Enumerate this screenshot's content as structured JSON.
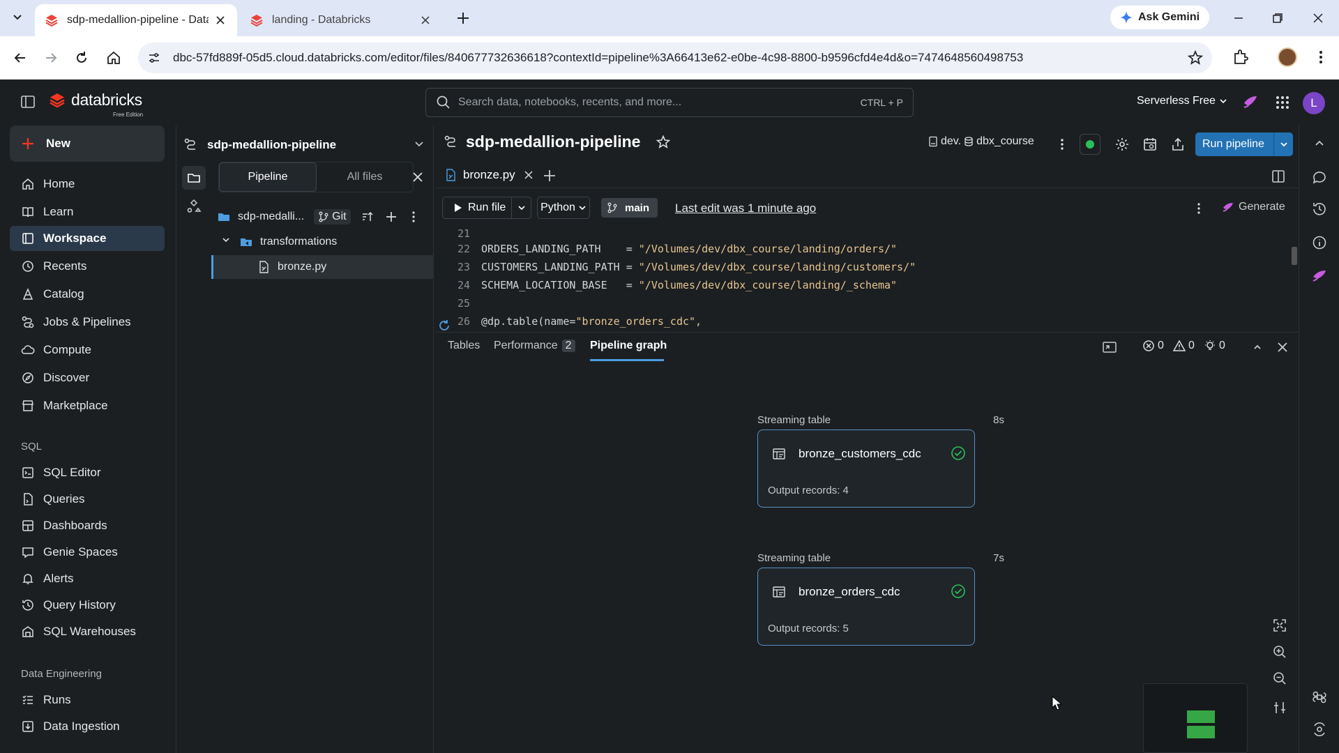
{
  "browser": {
    "tabs": [
      {
        "title": "sdp-medallion-pipeline - Datab",
        "active": true
      },
      {
        "title": "landing - Databricks",
        "active": false
      }
    ],
    "ask_gemini": "Ask Gemini",
    "url": "dbc-57fd889f-05d5.cloud.databricks.com/editor/files/840677732636618?contextId=pipeline%3A66413e62-e0be-4c98-8800-b9596cfd4e4d&o=7474648560498753"
  },
  "top": {
    "logo_text": "databricks",
    "edition": "Free Edition",
    "search_placeholder": "Search data, notebooks, recents, and more...",
    "search_shortcut": "CTRL + P",
    "compute": "Serverless Free",
    "avatar_letter": "L"
  },
  "nav": {
    "new_label": "New",
    "items": [
      "Home",
      "Learn",
      "Workspace",
      "Recents",
      "Catalog",
      "Jobs & Pipelines",
      "Compute",
      "Discover",
      "Marketplace"
    ],
    "sql_section": "SQL",
    "sql_items": [
      "SQL Editor",
      "Queries",
      "Dashboards",
      "Genie Spaces",
      "Alerts",
      "Query History",
      "SQL Warehouses"
    ],
    "de_section": "Data Engineering",
    "de_items": [
      "Runs",
      "Data Ingestion"
    ]
  },
  "filepanel": {
    "pipeline_name": "sdp-medallion-pipeline",
    "tabs": [
      "Pipeline",
      "All files"
    ],
    "root_folder": "sdp-medalli...",
    "git_label": "Git",
    "folder": "transformations",
    "file": "bronze.py"
  },
  "editor": {
    "title": "sdp-medallion-pipeline",
    "catalog": "dev.",
    "schema": "dbx_course",
    "run_pipeline": "Run pipeline",
    "open_file": "bronze.py",
    "run_file": "Run file",
    "language": "Python",
    "branch": "main",
    "last_edit": "Last edit was 1 minute ago",
    "generate": "Generate",
    "code_lines": [
      {
        "num": "21",
        "code": "",
        "str": ""
      },
      {
        "num": "22",
        "code": "ORDERS_LANDING_PATH    = ",
        "str": "\"/Volumes/dev/dbx_course/landing/orders/\""
      },
      {
        "num": "23",
        "code": "CUSTOMERS_LANDING_PATH = ",
        "str": "\"/Volumes/dev/dbx_course/landing/customers/\""
      },
      {
        "num": "24",
        "code": "SCHEMA_LOCATION_BASE   = ",
        "str": "\"/Volumes/dev/dbx_course/landing/_schema\""
      },
      {
        "num": "25",
        "code": "",
        "str": ""
      },
      {
        "num": "26",
        "code": "@dp.table(name=",
        "str": "\"bronze_orders_cdc\","
      }
    ]
  },
  "bottom": {
    "tabs": {
      "tables": "Tables",
      "performance": "Performance",
      "performance_count": "2",
      "graph": "Pipeline graph"
    },
    "errors": "0",
    "warnings": "0",
    "info": "0"
  },
  "graph": {
    "nodes": [
      {
        "type": "Streaming table",
        "duration": "8s",
        "name": "bronze_customers_cdc",
        "records": "Output records: 4"
      },
      {
        "type": "Streaming table",
        "duration": "7s",
        "name": "bronze_orders_cdc",
        "records": "Output records: 5"
      }
    ]
  },
  "colors": {
    "accent": "#2272b4",
    "success": "#2bbf5a",
    "node_border": "#5a8fc4"
  }
}
